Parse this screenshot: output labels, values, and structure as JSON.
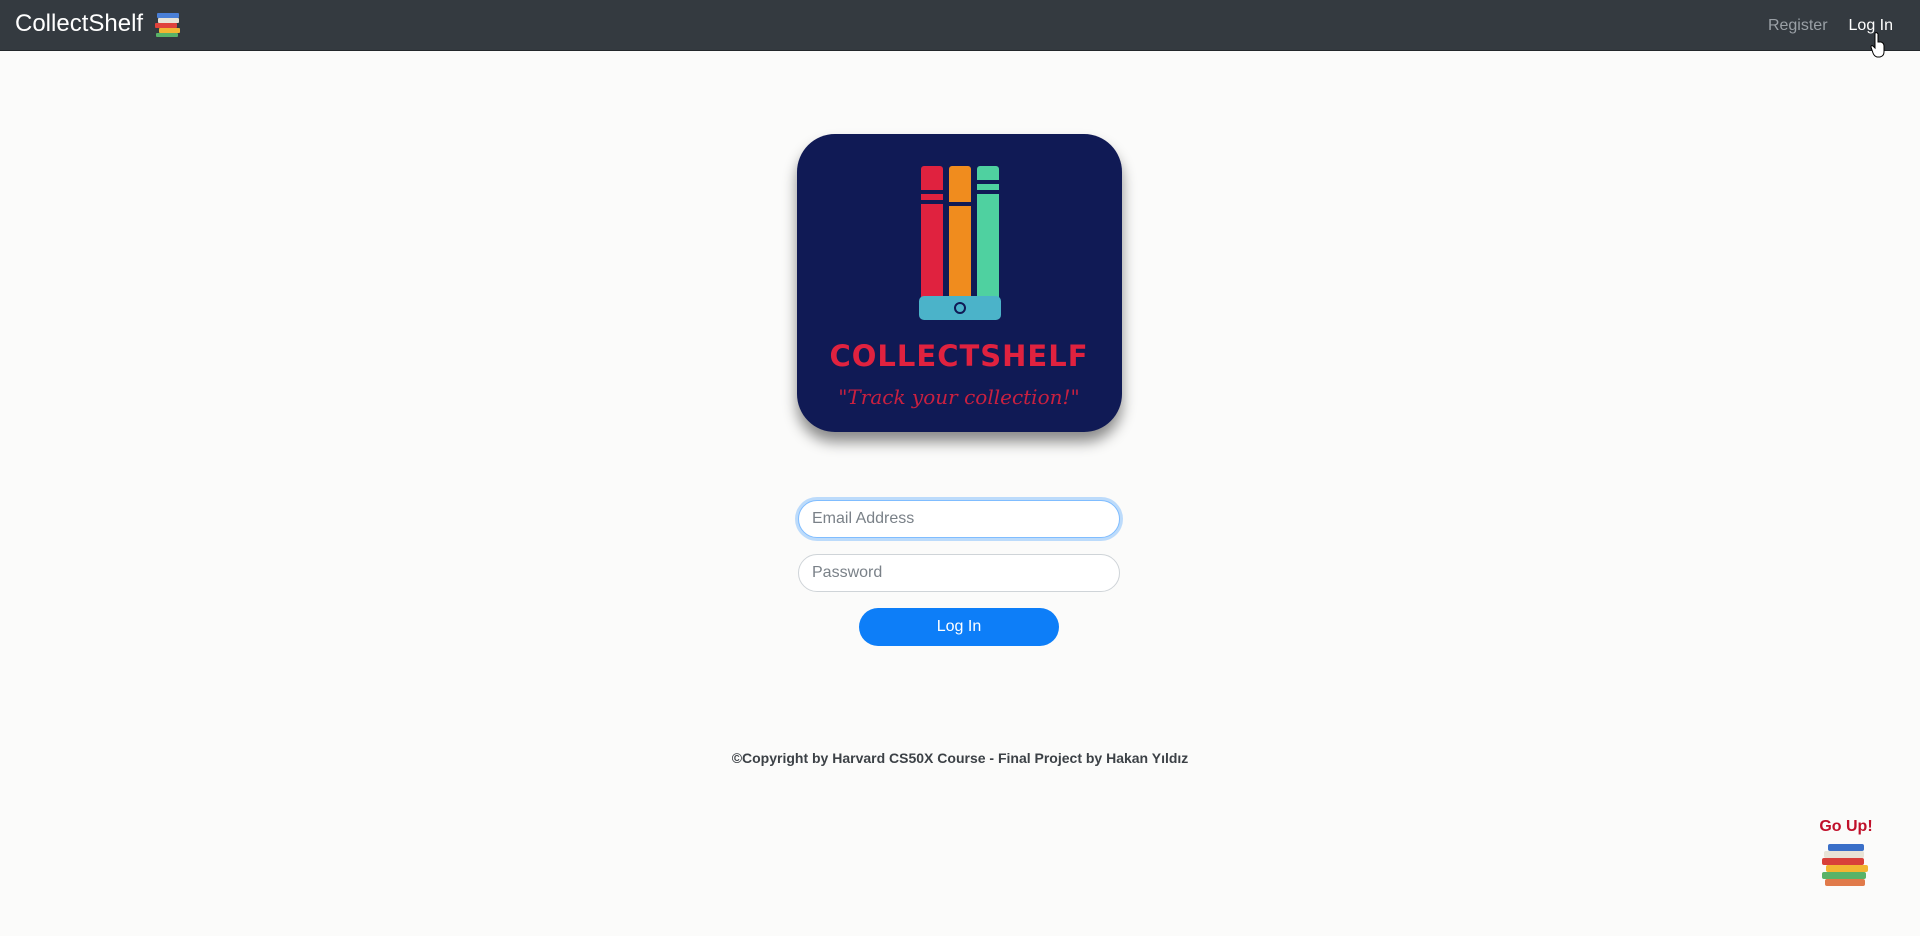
{
  "navbar": {
    "brand": "CollectShelf",
    "brand_icon": "books-stack-icon",
    "links": {
      "register": "Register",
      "login": "Log In"
    }
  },
  "logo": {
    "title": "COLLECTSHELF",
    "tagline": "\"Track your collection!\"",
    "colors": {
      "background": "#101a55",
      "red": "#e0223f",
      "orange": "#f08c1e",
      "green": "#4fd1a0",
      "teal": "#4bb3c9"
    }
  },
  "form": {
    "email_placeholder": "Email Address",
    "password_placeholder": "Password",
    "submit_label": "Log In"
  },
  "footer": {
    "copyright": "©Copyright by Harvard CS50X Course - Final Project by Hakan Yıldız"
  },
  "go_up": {
    "label": "Go Up!",
    "icon": "books-stack-icon"
  },
  "colors": {
    "navbar": "#343a40",
    "accent": "#0d7ef8",
    "go_up": "#c0102a"
  }
}
